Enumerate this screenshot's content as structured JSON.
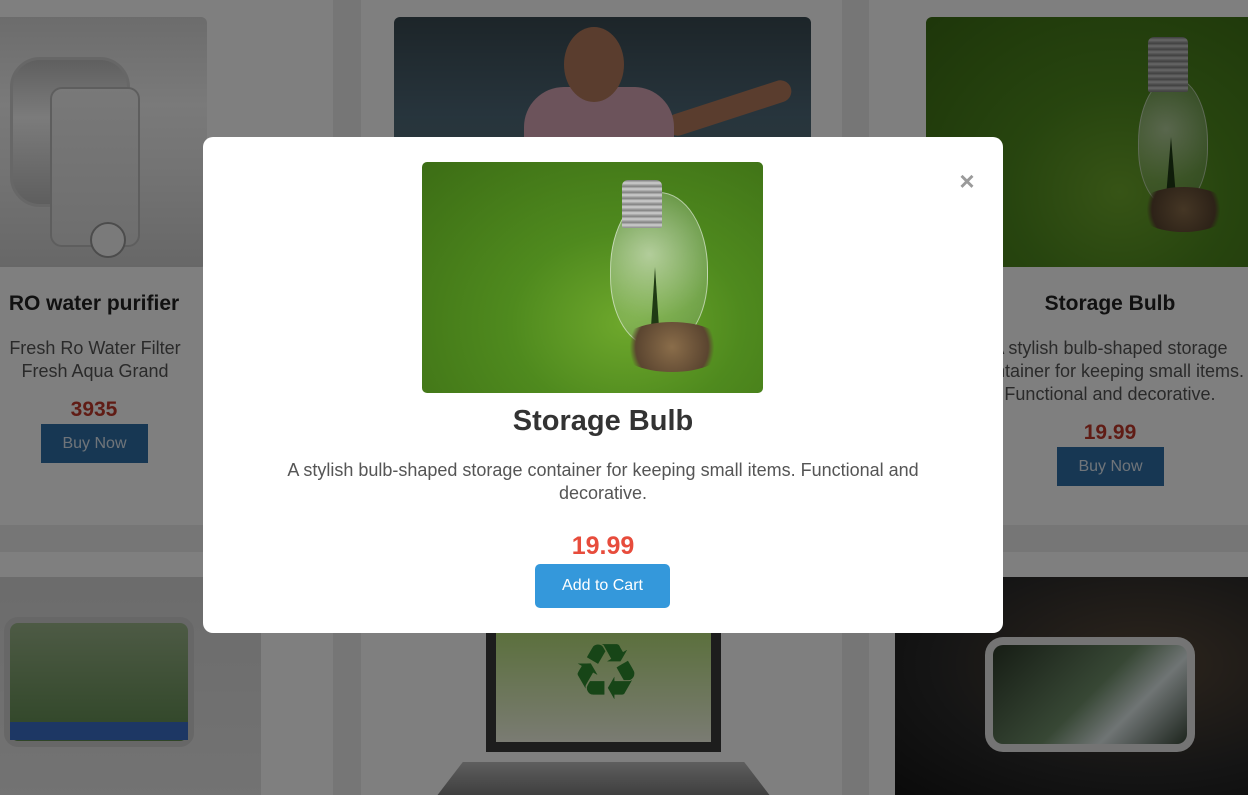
{
  "background_products": [
    {
      "title": "RO water purifier",
      "description": "Fresh Ro Water Filter Fresh Aqua Grand",
      "price": "3935",
      "button": "Buy Now"
    },
    {
      "title": "Storage Bulb",
      "description": "A stylish bulb-shaped storage container for keeping small items. Functional and decorative.",
      "price": "19.99",
      "button": "Buy Now"
    }
  ],
  "modal": {
    "title": "Storage Bulb",
    "description": "A stylish bulb-shaped storage container for keeping small items. Functional and decorative.",
    "price": "19.99",
    "add_to_cart_label": "Add to Cart",
    "close_icon": "×"
  },
  "colors": {
    "overlay": "rgba(0,0,0,0.5)",
    "price_red": "#e74c3c",
    "cart_blue": "#3498db",
    "buy_blue": "#2f6fa6"
  }
}
